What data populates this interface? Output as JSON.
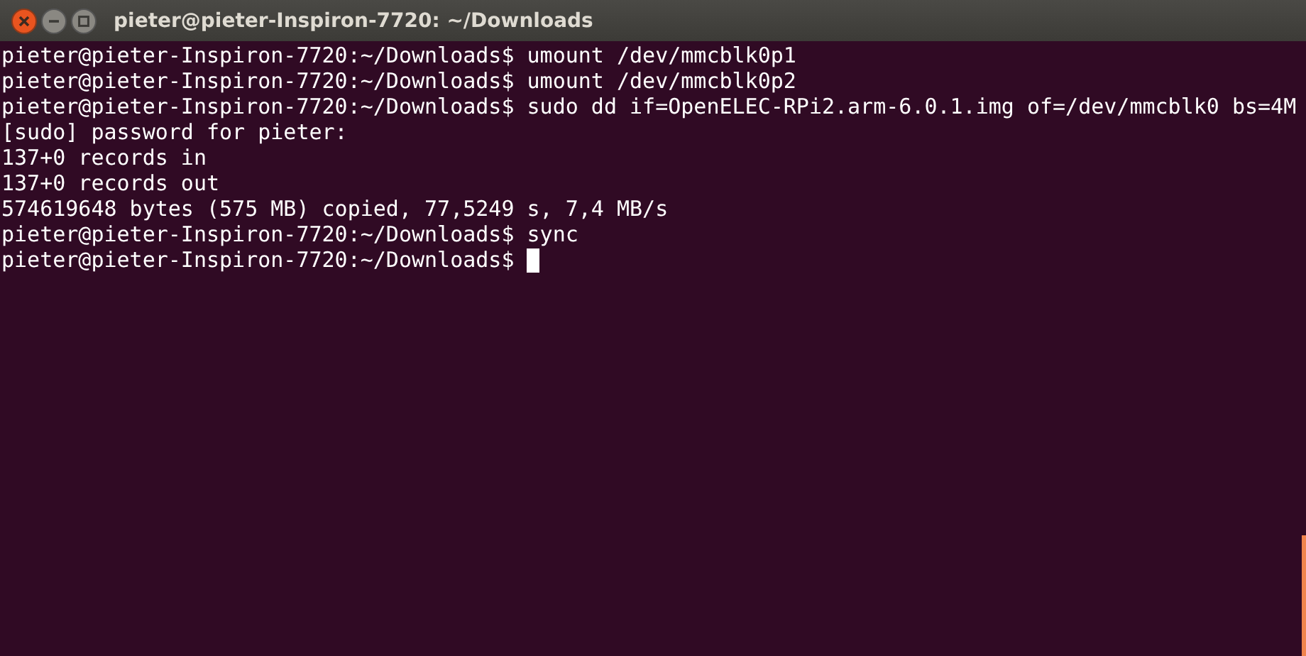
{
  "window": {
    "title": "pieter@pieter-Inspiron-7720: ~/Downloads"
  },
  "terminal": {
    "lines": [
      {
        "text": "pieter@pieter-Inspiron-7720:~/Downloads$ umount /dev/mmcblk0p1",
        "cursor": false
      },
      {
        "text": "pieter@pieter-Inspiron-7720:~/Downloads$ umount /dev/mmcblk0p2",
        "cursor": false
      },
      {
        "text": "pieter@pieter-Inspiron-7720:~/Downloads$ sudo dd if=OpenELEC-RPi2.arm-6.0.1.img of=/dev/mmcblk0 bs=4M",
        "cursor": false
      },
      {
        "text": "[sudo] password for pieter:",
        "cursor": false
      },
      {
        "text": "137+0 records in",
        "cursor": false
      },
      {
        "text": "137+0 records out",
        "cursor": false
      },
      {
        "text": "574619648 bytes (575 MB) copied, 77,5249 s, 7,4 MB/s",
        "cursor": false
      },
      {
        "text": "pieter@pieter-Inspiron-7720:~/Downloads$ sync",
        "cursor": false
      },
      {
        "text": "pieter@pieter-Inspiron-7720:~/Downloads$",
        "cursor": true
      }
    ]
  }
}
